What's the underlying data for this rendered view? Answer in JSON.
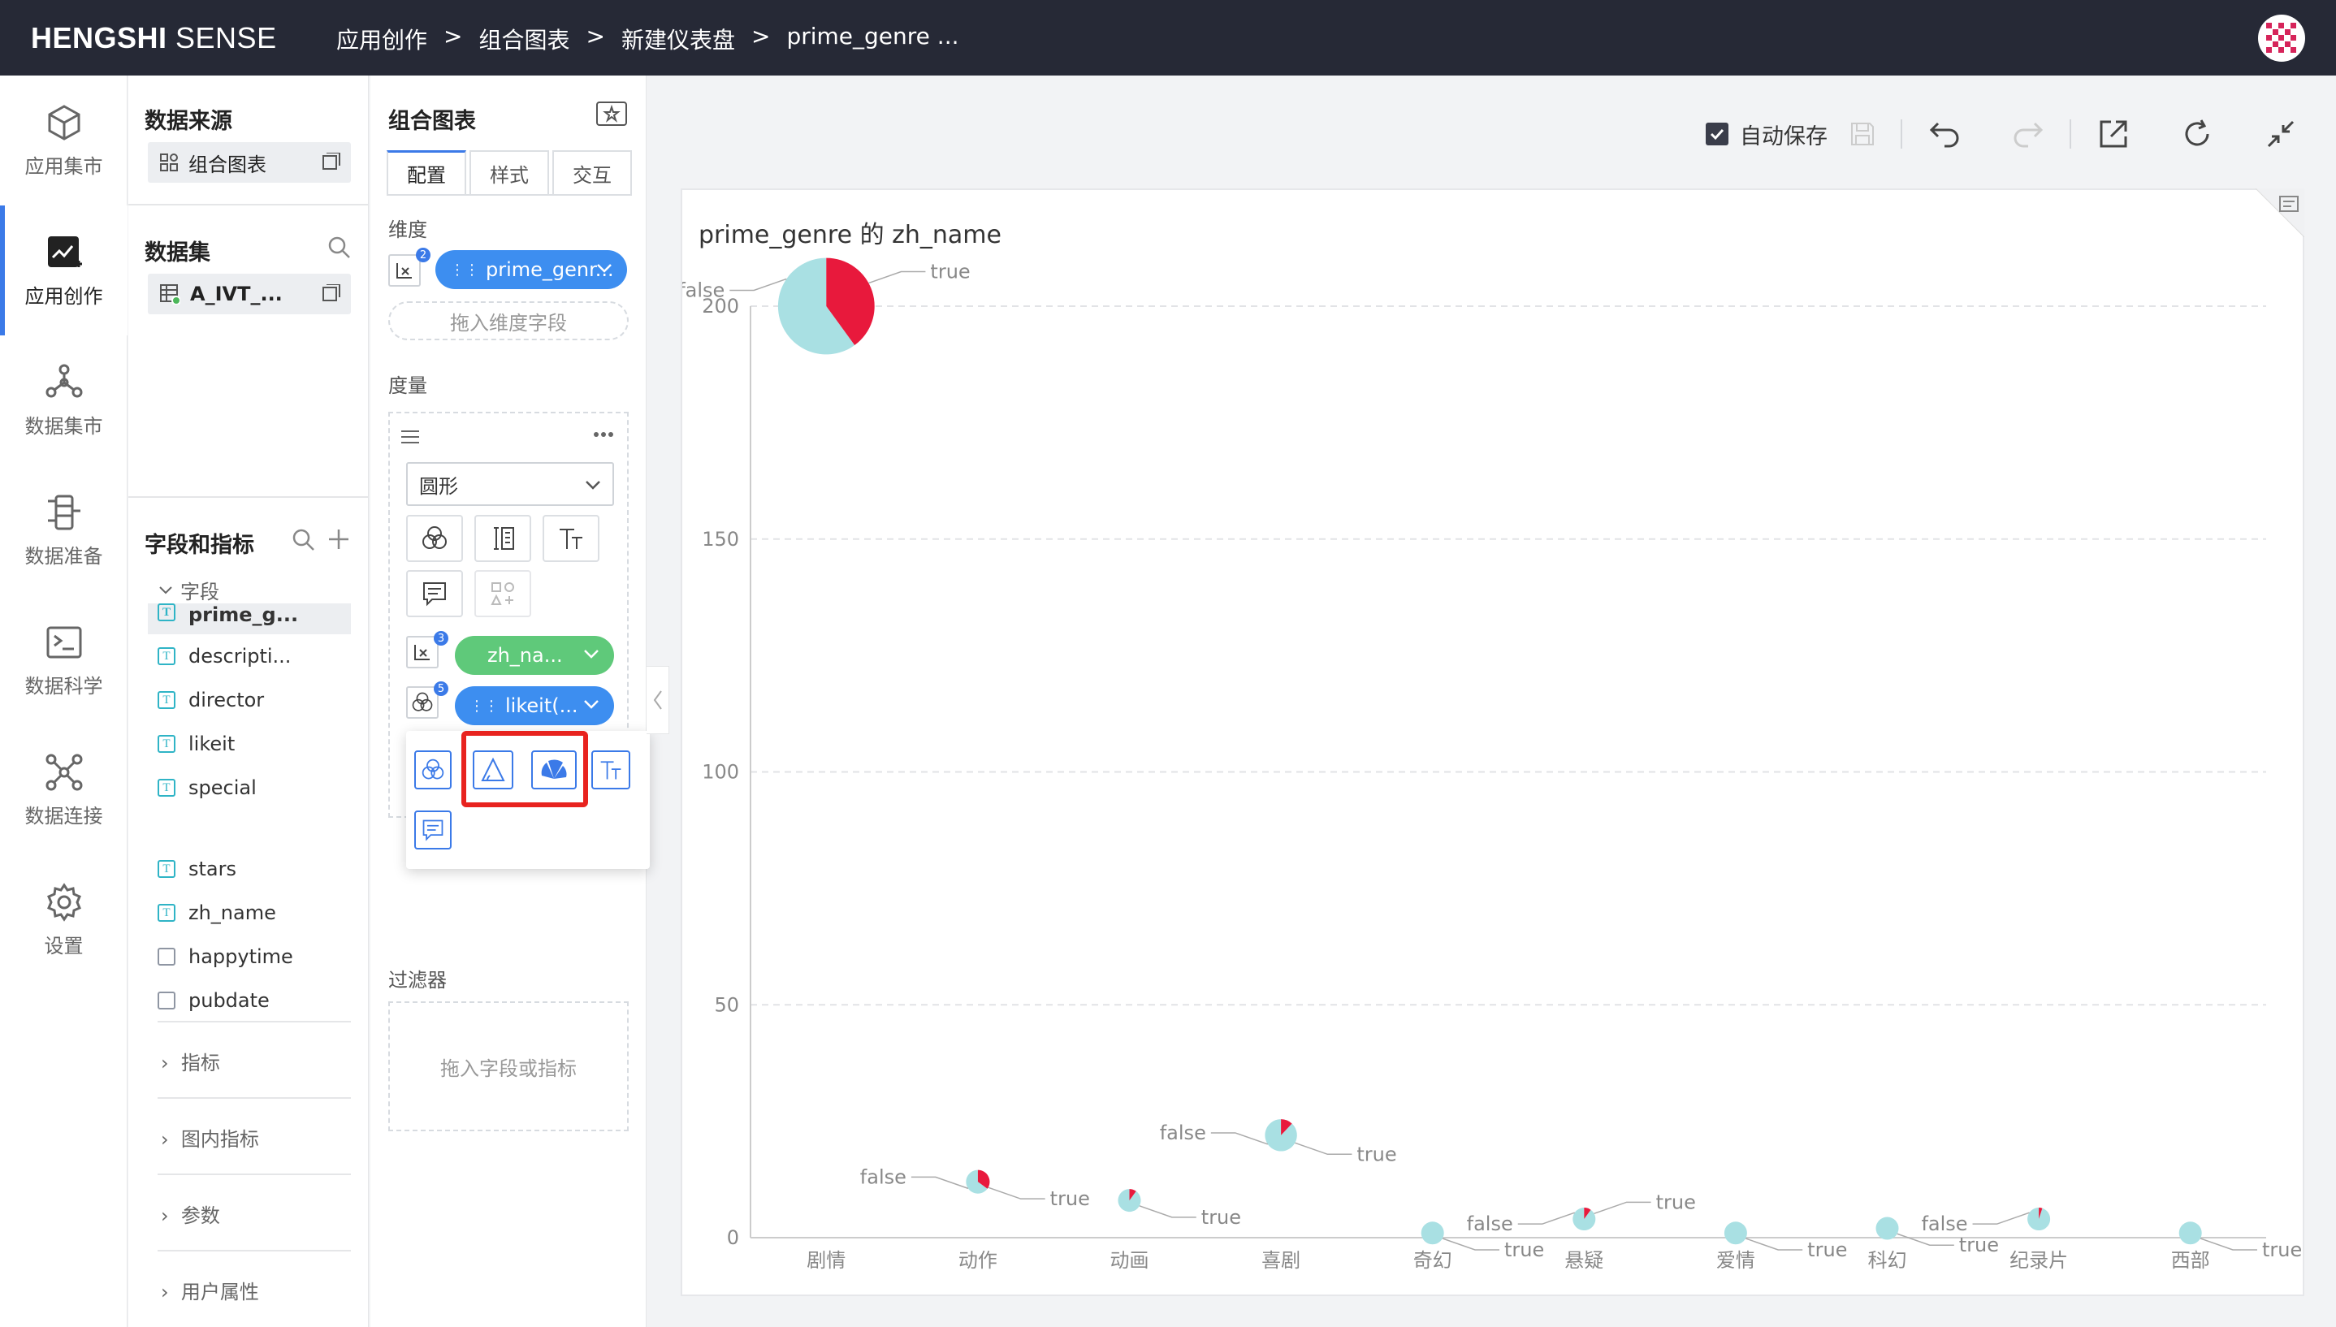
{
  "app": {
    "brand_bold": "HENGSHI",
    "brand_light": " SENSE",
    "breadcrumbs": [
      "应用创作",
      "组合图表",
      "新建仪表盘",
      "prime_genre ..."
    ],
    "breadcrumb_sep": ">"
  },
  "nav": [
    {
      "label": "应用集市",
      "icon": "cube-icon"
    },
    {
      "label": "应用创作",
      "icon": "chart-edit-icon",
      "active": true
    },
    {
      "label": "数据集市",
      "icon": "network-icon"
    },
    {
      "label": "数据准备",
      "icon": "data-prep-icon"
    },
    {
      "label": "数据科学",
      "icon": "terminal-icon"
    },
    {
      "label": "数据连接",
      "icon": "connection-icon"
    },
    {
      "label": "设置",
      "icon": "gear-icon"
    }
  ],
  "panel1": {
    "source_title": "数据来源",
    "source_name": "组合图表",
    "dataset_title": "数据集",
    "dataset_name": "A_IVT_...",
    "fields_title": "字段和指标",
    "fields_group": "字段",
    "fields": [
      {
        "name": "prime_g...",
        "type": "text",
        "selected": true
      },
      {
        "name": "descripti...",
        "type": "text"
      },
      {
        "name": "director",
        "type": "text"
      },
      {
        "name": "likeit",
        "type": "text"
      },
      {
        "name": "special",
        "type": "text"
      },
      {
        "name": "stars",
        "type": "text"
      },
      {
        "name": "zh_name",
        "type": "text"
      },
      {
        "name": "happytime",
        "type": "date"
      },
      {
        "name": "pubdate",
        "type": "date"
      }
    ],
    "groups": [
      "指标",
      "图内指标",
      "参数",
      "用户属性"
    ]
  },
  "panel2": {
    "title": "组合图表",
    "tabs": [
      "配置",
      "样式",
      "交互"
    ],
    "dimension_label": "维度",
    "dimension_pill": "prime_genr...",
    "dimension_badge": "2",
    "dimension_drop": "拖入维度字段",
    "measure_label": "度量",
    "shape_select": "圆形",
    "measure_pill_1": "zh_na...",
    "measure_badge_1": "3",
    "measure_pill_2": "likeit(...",
    "measure_badge_2": "5",
    "filter_label": "过滤器",
    "filter_drop": "拖入字段或指标"
  },
  "toolbar": {
    "autosave_label": "自动保存",
    "autosave_checked": true
  },
  "chart_data": {
    "type": "pie-scatter",
    "title": "prime_genre 的 zh_name",
    "categories": [
      "剧情",
      "动作",
      "动画",
      "喜剧",
      "奇幻",
      "悬疑",
      "爱情",
      "科幻",
      "纪录片",
      "西部"
    ],
    "y_ticks": [
      0,
      50,
      100,
      150,
      200
    ],
    "ylim": [
      0,
      200
    ],
    "colors": {
      "true": "#a9e0e3",
      "false": "#e8193c"
    },
    "series": [
      {
        "category": "剧情",
        "y": 200,
        "true_share": 0.6,
        "labels": [
          {
            "text": "false"
          },
          {
            "text": "true"
          }
        ]
      },
      {
        "category": "动作",
        "y": 12,
        "true_share": 0.65,
        "labels": [
          {
            "text": "true"
          },
          {
            "text": "false"
          }
        ]
      },
      {
        "category": "动画",
        "y": 8,
        "true_share": 0.9,
        "labels": [
          {
            "text": "true"
          }
        ]
      },
      {
        "category": "喜剧",
        "y": 22,
        "true_share": 0.88,
        "labels": [
          {
            "text": "true"
          },
          {
            "text": "false"
          }
        ]
      },
      {
        "category": "奇幻",
        "y": 1,
        "true_share": 1.0,
        "labels": [
          {
            "text": "true"
          }
        ]
      },
      {
        "category": "悬疑",
        "y": 4,
        "true_share": 0.9,
        "labels": [
          {
            "text": "false"
          },
          {
            "text": "true"
          }
        ]
      },
      {
        "category": "爱情",
        "y": 1,
        "true_share": 1.0,
        "labels": [
          {
            "text": "true"
          }
        ]
      },
      {
        "category": "科幻",
        "y": 2,
        "true_share": 1.0,
        "labels": [
          {
            "text": "true"
          }
        ]
      },
      {
        "category": "纪录片",
        "y": 4,
        "true_share": 0.95,
        "labels": [
          {
            "text": "false"
          }
        ]
      },
      {
        "category": "西部",
        "y": 1,
        "true_share": 1.0,
        "labels": [
          {
            "text": "true"
          }
        ]
      }
    ]
  }
}
